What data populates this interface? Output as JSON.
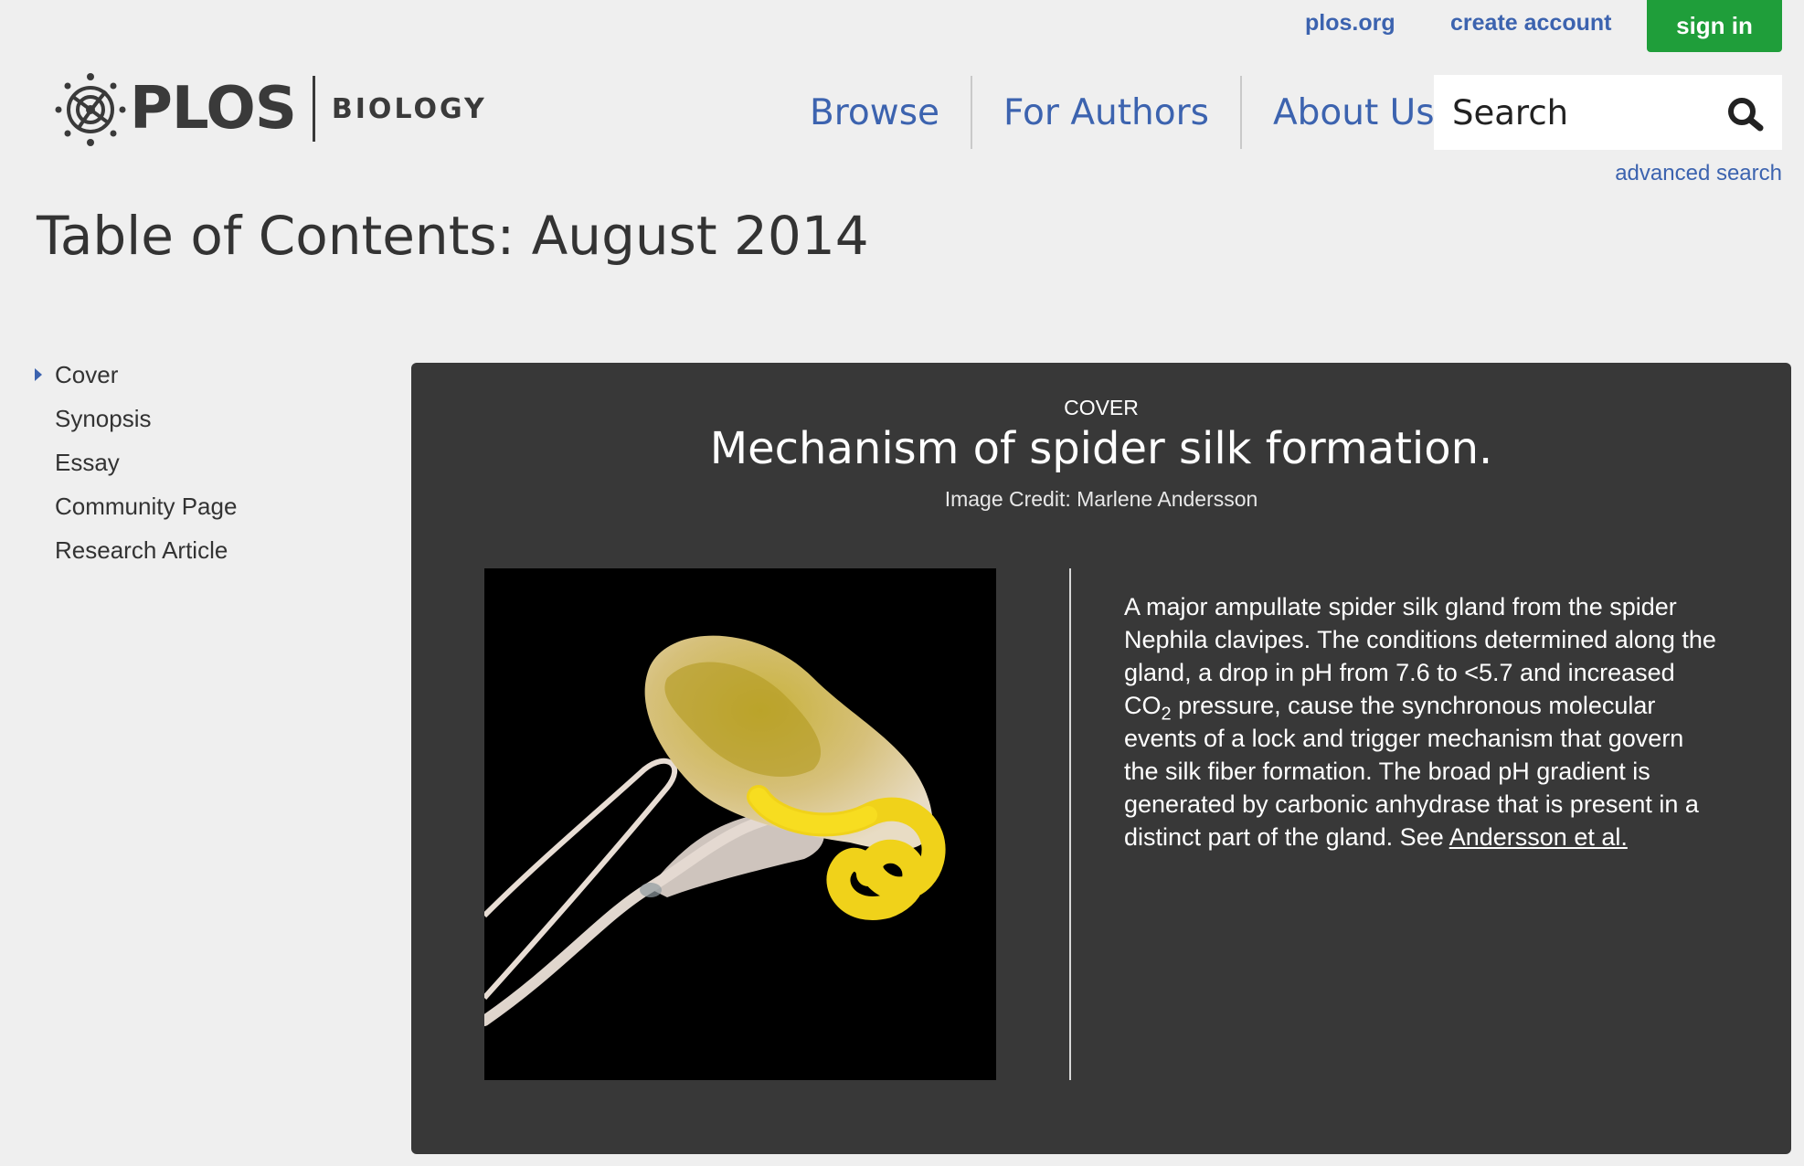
{
  "utility_nav": {
    "plos_org": "plos.org",
    "create_account": "create account",
    "sign_in": "sign in"
  },
  "logo": {
    "brand": "PLOS",
    "journal": "BIOLOGY"
  },
  "main_nav": {
    "items": [
      {
        "label": "Browse"
      },
      {
        "label": "For Authors"
      },
      {
        "label": "About Us"
      }
    ]
  },
  "search": {
    "placeholder": "Search",
    "advanced_link": "advanced search"
  },
  "page": {
    "title": "Table of Contents: August 2014"
  },
  "toc_nav": {
    "items": [
      {
        "label": "Cover",
        "active": true
      },
      {
        "label": "Synopsis"
      },
      {
        "label": "Essay"
      },
      {
        "label": "Community Page"
      },
      {
        "label": "Research Article"
      }
    ]
  },
  "cover": {
    "section_label": "COVER",
    "title": "Mechanism of spider silk formation.",
    "credit": "Image Credit: Marlene Andersson",
    "description_before_sub": "A major ampullate spider silk gland from the spider Nephila clavipes. The conditions determined along the gland, a drop in pH from 7.6 to <5.7 and increased CO",
    "description_sub": "2",
    "description_after_sub": " pressure, cause the synchronous molecular events of a lock and trigger mechanism that govern the silk fiber formation. The broad pH gradient is generated by carbonic anhydrase that is present in a distinct part of the gland. See ",
    "reference_link": "Andersson et al."
  },
  "colors": {
    "link_blue": "#3c63af",
    "sign_in_green": "#1f9e3a",
    "cover_panel": "#383838",
    "page_bg": "#efefef"
  }
}
